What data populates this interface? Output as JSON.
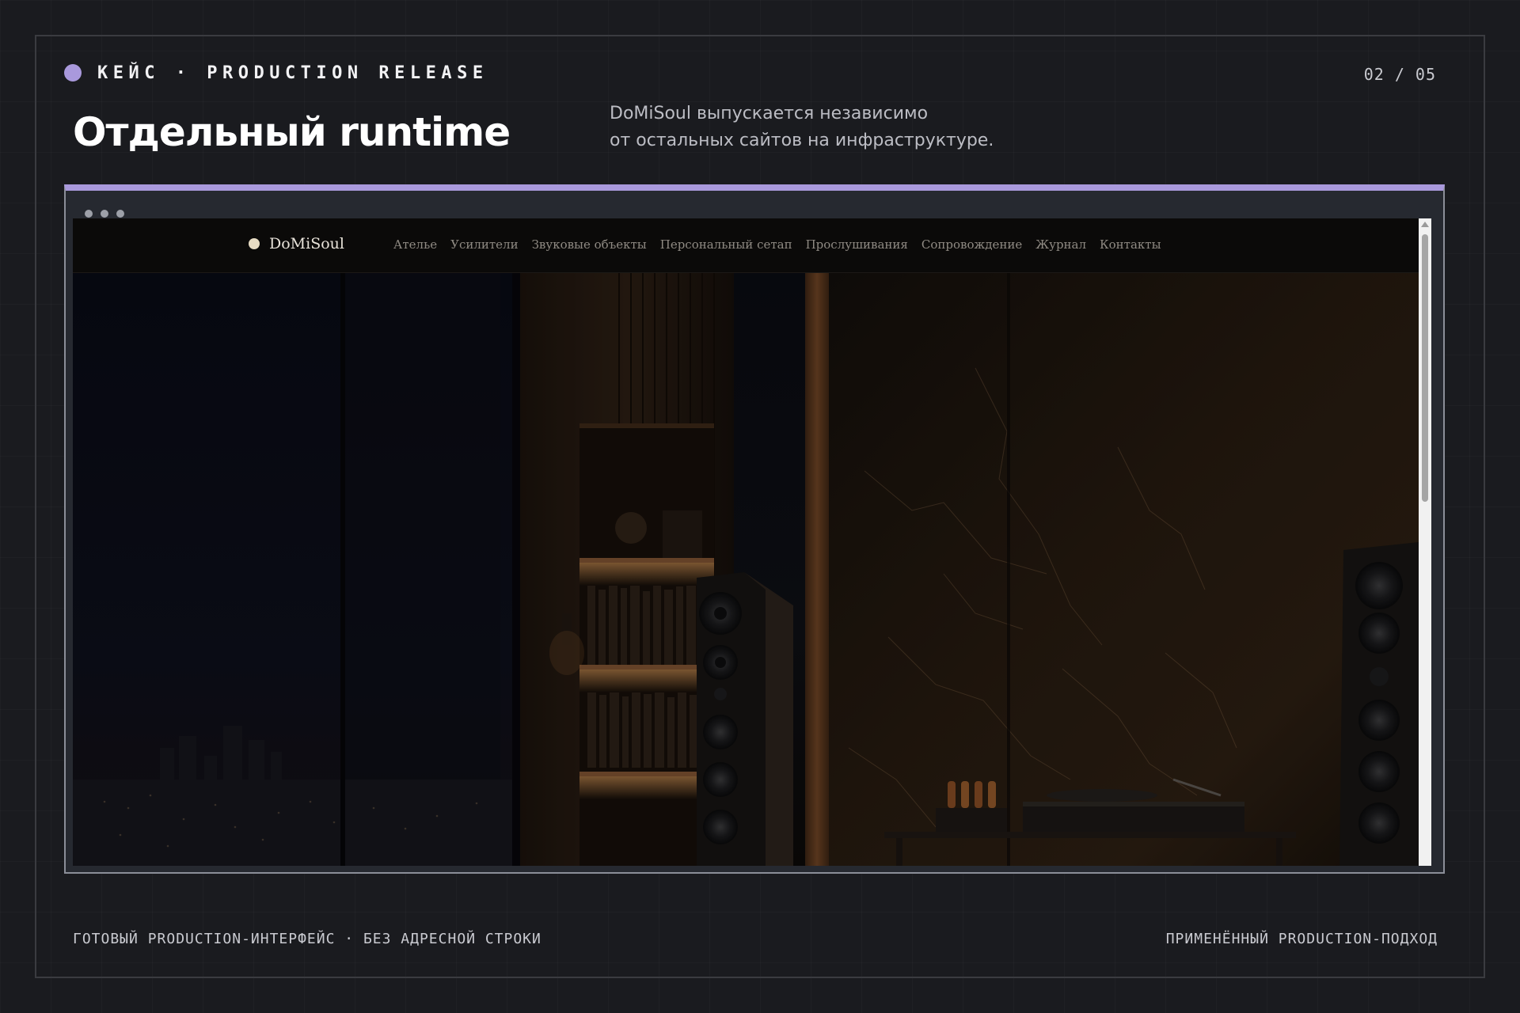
{
  "slide": {
    "kicker": "КЕЙС · PRODUCTION RELEASE",
    "pager": "02 / 05",
    "title": "Отдельный runtime",
    "subtitle_lines": [
      "DoMiSoul выпускается независимо",
      "от остальных сайтов на инфраструктуре."
    ],
    "accent_color": "#a999dc"
  },
  "browser": {
    "site": {
      "brand": "DoMiSoul",
      "nav": [
        "Ателье",
        "Усилители",
        "Звуковые объекты",
        "Персональный сетап",
        "Прослушивания",
        "Сопровождение",
        "Журнал",
        "Контакты"
      ]
    },
    "hero_image": "dark listening room with floor-standing speakers, tube amplifier, turntable and city view"
  },
  "footer": {
    "left": "ГОТОВЫЙ PRODUCTION-ИНТЕРФЕЙС · БЕЗ АДРЕСНОЙ СТРОКИ",
    "right": "ПРИМЕНЁННЫЙ PRODUCTION-ПОДХОД"
  }
}
